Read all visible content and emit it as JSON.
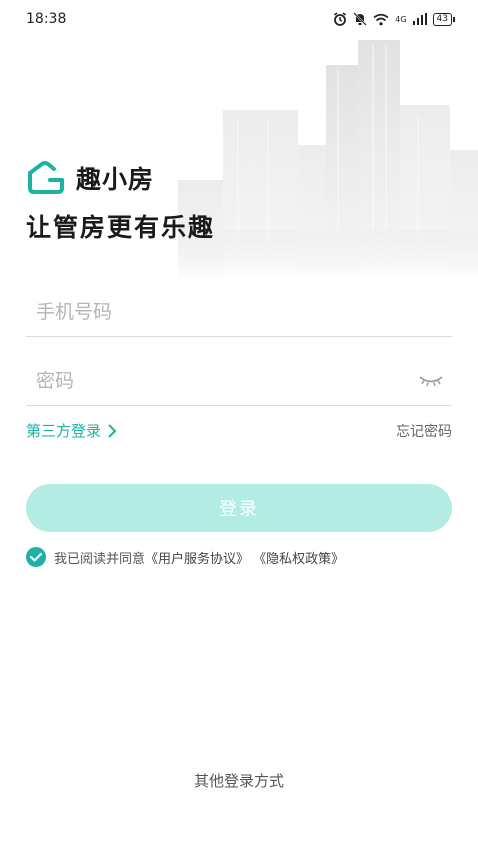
{
  "status_bar": {
    "time": "18:38",
    "signal_label": "4G",
    "battery": "43",
    "icons": [
      "alarm-icon",
      "mute-icon",
      "wifi-icon",
      "signal-icon",
      "battery-icon"
    ]
  },
  "brand": {
    "app_name": "趣小房",
    "slogan": "让管房更有乐趣",
    "accent_color": "#1fb1a3"
  },
  "form": {
    "phone_placeholder": "手机号码",
    "password_placeholder": "密码",
    "third_party_label": "第三方登录",
    "forgot_label": "忘记密码",
    "login_label": "登录"
  },
  "agreement": {
    "checked": true,
    "prefix": "我已阅读并同意",
    "user_agreement": "《用户服务协议》",
    "privacy_policy": "《隐私权政策》"
  },
  "footer": {
    "other_login": "其他登录方式"
  }
}
